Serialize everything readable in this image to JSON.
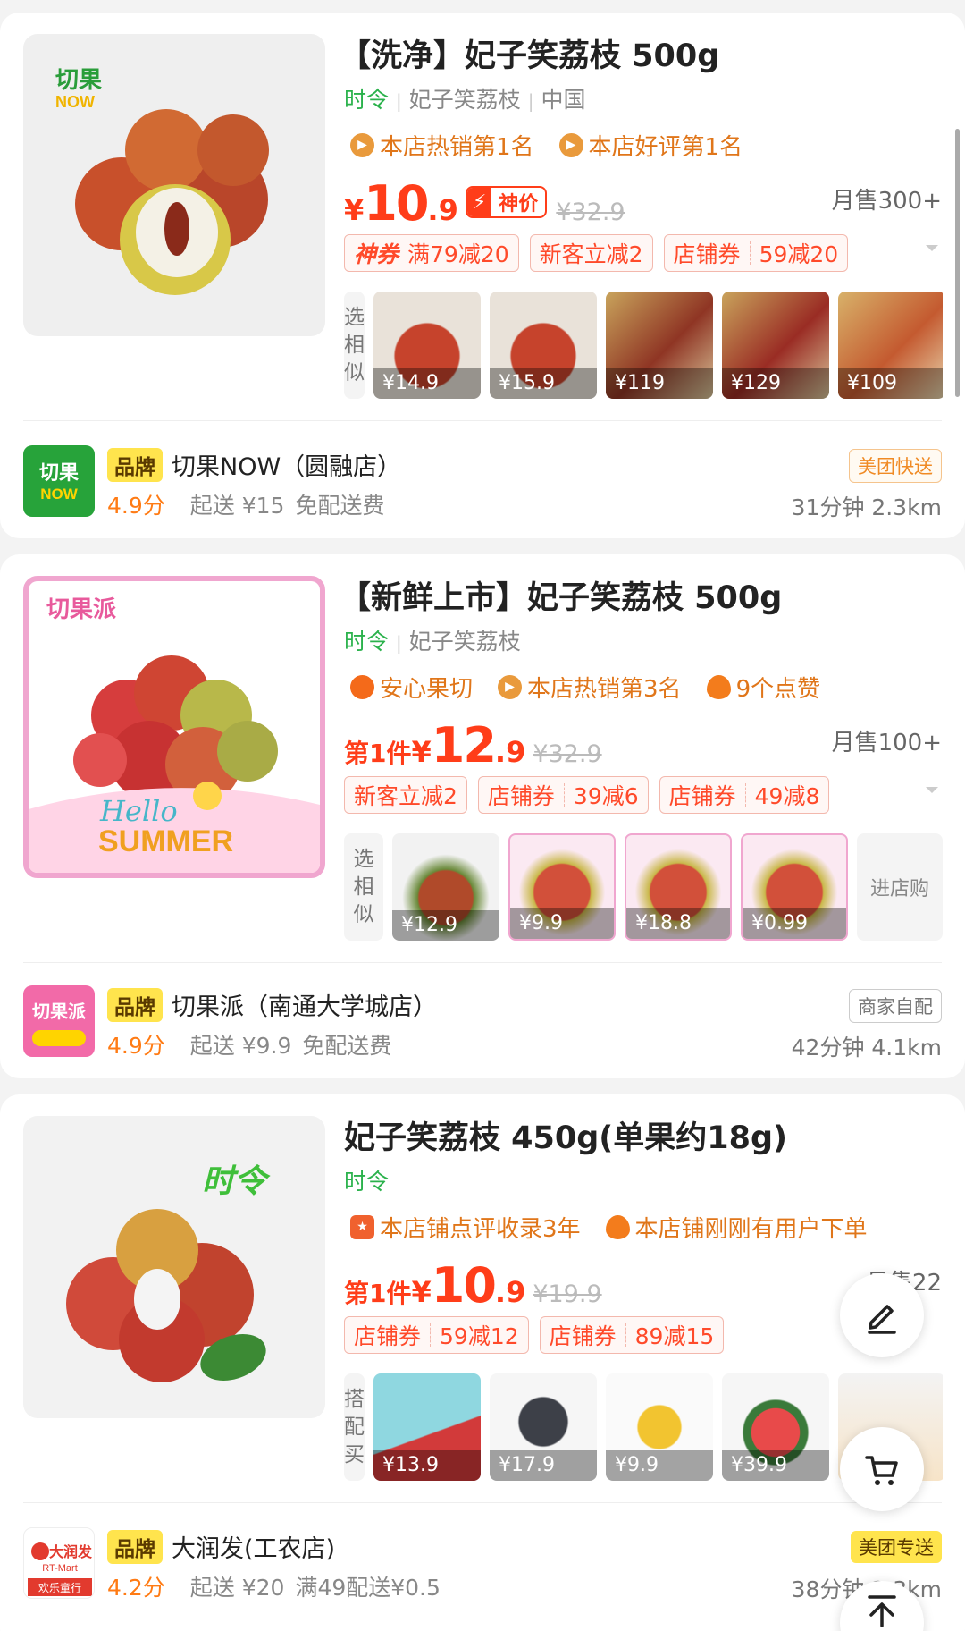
{
  "products": [
    {
      "title": "【洗净】妃子笑荔枝 500g",
      "tag": "时令",
      "attrs": [
        "妃子笑荔枝",
        "中国"
      ],
      "badges": [
        "本店热销第1名",
        "本店好评第1名"
      ],
      "price_prefix": "",
      "price_int": "10",
      "price_dec": ".9",
      "deal_label": "神价",
      "orig_price": "¥32.9",
      "monthly": "月售300+",
      "coupons": [
        {
          "a": "神券",
          "b": "满79减20"
        },
        {
          "a": "新客立减2",
          "b": ""
        },
        {
          "a": "店铺券",
          "b": "59减20"
        }
      ],
      "similar_label": [
        "选",
        "相",
        "似"
      ],
      "similar_prices": [
        "¥14.9",
        "¥15.9",
        "¥119",
        "¥129",
        "¥109"
      ],
      "logo_text": [
        "切果",
        "NOW"
      ],
      "store": {
        "brand_tag": "品牌",
        "name": "切果NOW（圆融店）",
        "rating": "4.9分",
        "min_order": "起送 ¥15",
        "fee": "免配送费",
        "delivery_tag": "美团快送",
        "distance": "31分钟  2.3km"
      }
    },
    {
      "title": "【新鲜上市】妃子笑荔枝 500g",
      "tag": "时令",
      "attrs": [
        "妃子笑荔枝"
      ],
      "badges": [
        "安心果切",
        "本店热销第3名",
        "9个点赞"
      ],
      "price_prefix": "第1件",
      "price_int": "12",
      "price_dec": ".9",
      "orig_price": "¥32.9",
      "monthly": "月售100+",
      "coupons": [
        {
          "a": "新客立减2",
          "b": ""
        },
        {
          "a": "店铺券",
          "b": "39减6"
        },
        {
          "a": "店铺券",
          "b": "49减8"
        }
      ],
      "similar_label": [
        "选",
        "相",
        "似"
      ],
      "similar_prices": [
        "¥12.9",
        "¥9.9",
        "¥18.8",
        "¥0.99"
      ],
      "enter_store": "进店购",
      "logo_text": [
        "切果派",
        "Hello",
        "SUMMER"
      ],
      "store": {
        "brand_tag": "品牌",
        "name": "切果派（南通大学城店）",
        "rating": "4.9分",
        "min_order": "起送 ¥9.9",
        "fee": "免配送费",
        "delivery_tag": "商家自配",
        "distance": "42分钟  4.1km"
      }
    },
    {
      "title": "妃子笑荔枝 450g(单果约18g)",
      "tag": "时令",
      "badges": [
        "本店铺点评收录3年",
        "本店铺刚刚有用户下单"
      ],
      "price_prefix": "第1件",
      "price_int": "10",
      "price_dec": ".9",
      "orig_price": "¥19.9",
      "monthly": "月售22",
      "coupons": [
        {
          "a": "店铺券",
          "b": "59减12"
        },
        {
          "a": "店铺券",
          "b": "89减15"
        }
      ],
      "similar_label": [
        "搭",
        "配",
        "买"
      ],
      "similar_prices": [
        "¥13.9",
        "¥17.9",
        "¥9.9",
        "¥39.9"
      ],
      "image_tag": "时令",
      "logo_text": [
        "大润发",
        "RT-Mart",
        "欢乐童行"
      ],
      "store": {
        "brand_tag": "品牌",
        "name": "大润发(工农店)",
        "rating": "4.2分",
        "min_order": "起送 ¥20",
        "fee": "满49配送¥0.5",
        "delivery_tag": "美团专送",
        "distance": "38分钟  2.3km"
      }
    }
  ],
  "colors": {
    "accent": "#ff3d19",
    "green": "#2bb24c",
    "orange": "#ff7b14",
    "brand_yellow": "#ffe44d"
  },
  "icons": [
    "edit-icon",
    "cart-icon",
    "back-to-top-icon"
  ]
}
